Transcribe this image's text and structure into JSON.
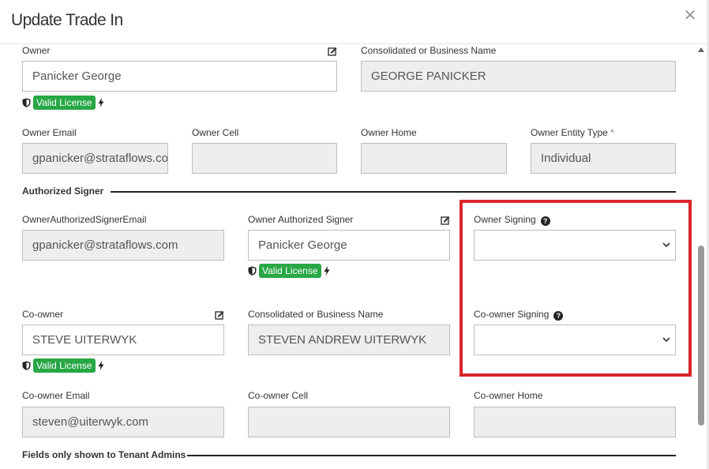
{
  "modal": {
    "title": "Update Trade In",
    "close_symbol": "✕"
  },
  "owner": {
    "label": "Owner",
    "value": "Panicker George",
    "license": "Valid License"
  },
  "owner_business": {
    "label": "Consolidated or Business Name",
    "value": "GEORGE PANICKER"
  },
  "owner_email": {
    "label": "Owner Email",
    "value": "gpanicker@strataflows.com"
  },
  "owner_cell": {
    "label": "Owner Cell",
    "value": ""
  },
  "owner_home": {
    "label": "Owner Home",
    "value": ""
  },
  "owner_entity_type": {
    "label": "Owner Entity Type",
    "required_mark": "*",
    "value": "Individual"
  },
  "authorized_signer_section": {
    "title": "Authorized Signer"
  },
  "owner_authorized_signer_email": {
    "label": "OwnerAuthorizedSignerEmail",
    "value": "gpanicker@strataflows.com"
  },
  "owner_authorized_signer": {
    "label": "Owner Authorized Signer",
    "value": "Panicker George",
    "license": "Valid License"
  },
  "owner_signing": {
    "label": "Owner Signing",
    "value": ""
  },
  "coowner": {
    "label": "Co-owner",
    "value": "STEVE UITERWYK",
    "license": "Valid License"
  },
  "coowner_business": {
    "label": "Consolidated or Business Name",
    "value": "STEVEN ANDREW UITERWYK"
  },
  "coowner_signing": {
    "label": "Co-owner Signing",
    "value": ""
  },
  "coowner_email": {
    "label": "Co-owner Email",
    "value": "steven@uiterwyk.com"
  },
  "coowner_cell": {
    "label": "Co-owner Cell",
    "value": ""
  },
  "coowner_home": {
    "label": "Co-owner Home",
    "value": ""
  },
  "tenant_admin_section": {
    "title": "Fields only shown to Tenant Admins"
  },
  "help_symbol": "?",
  "colors": {
    "highlight": "#d9242a",
    "license_badge": "#28a745",
    "disabled_input": "#eeeeee"
  },
  "icons": [
    "close-icon",
    "edit-icon",
    "shield-icon",
    "bolt-icon",
    "help-icon",
    "chevron-down-icon",
    "scroll-up-icon"
  ]
}
